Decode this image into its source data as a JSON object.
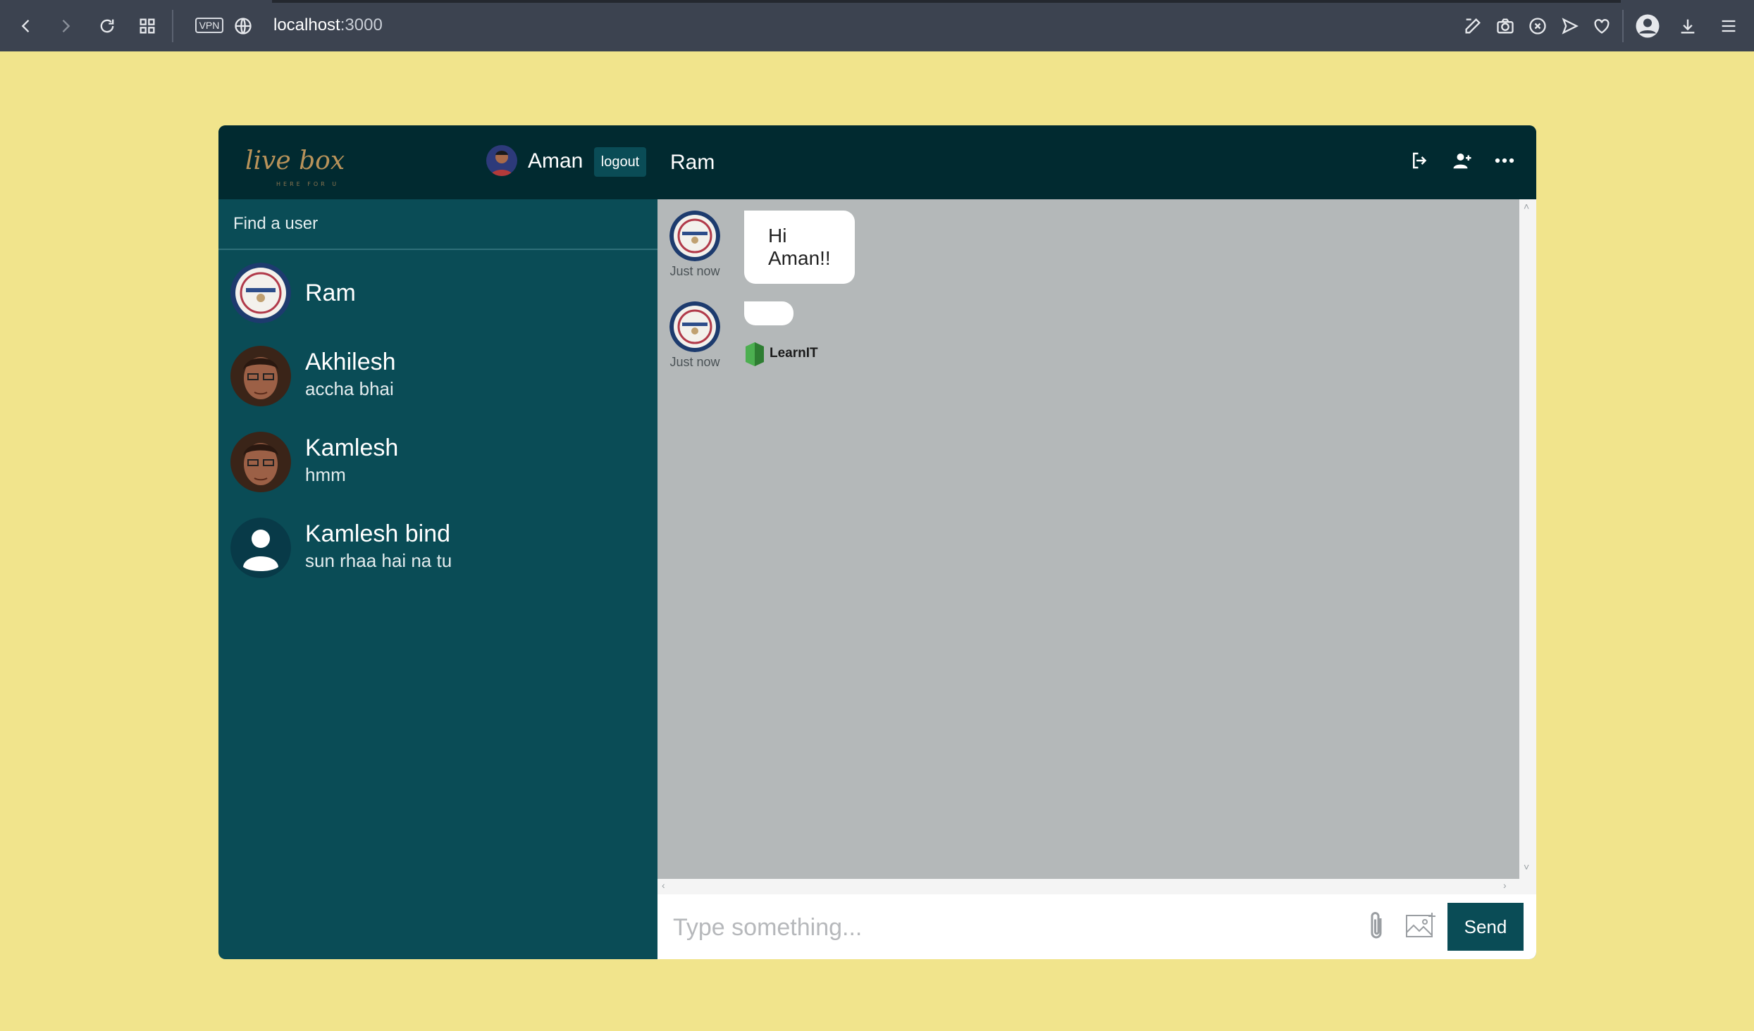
{
  "browser": {
    "vpn_label": "VPN",
    "url_host": "localhost",
    "url_port": ":3000"
  },
  "app": {
    "logo_text": "live box",
    "logo_tagline": "HERE FOR U",
    "current_user": "Aman",
    "logout_label": "logout",
    "search_placeholder": "Find a user",
    "chats": [
      {
        "name": "Ram",
        "last": ""
      },
      {
        "name": "Akhilesh",
        "last": "accha bhai"
      },
      {
        "name": "Kamlesh",
        "last": "hmm"
      },
      {
        "name": "Kamlesh bind",
        "last": "sun rhaa hai na tu"
      }
    ],
    "active_chat": "Ram",
    "chat_icons": [
      "logout-icon",
      "add-user-icon",
      "more-icon"
    ],
    "messages": [
      {
        "text": "Hi Aman!!",
        "time": "Just now"
      },
      {
        "text": "",
        "time": "Just now",
        "image_caption": "LearnIT"
      }
    ],
    "composer_placeholder": "Type something...",
    "send_label": "Send"
  },
  "colors": {
    "page_bg": "#f1e48c",
    "sidebar_bg": "#0a4c56",
    "navbar_bg": "#012a30",
    "chat_bg": "#b4b8b9",
    "accent": "#0a4c56"
  }
}
